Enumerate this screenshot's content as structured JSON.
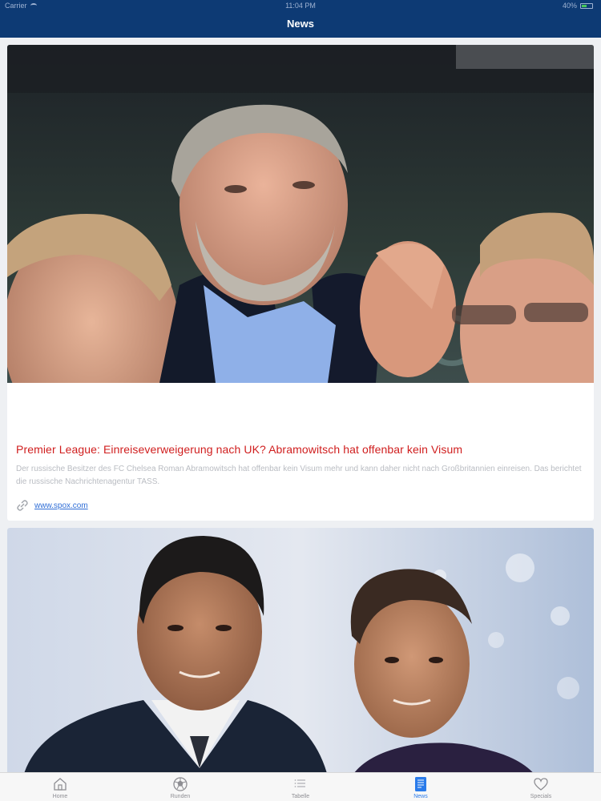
{
  "status_bar": {
    "carrier": "Carrier",
    "time": "11:04 PM",
    "battery": "40%"
  },
  "header": {
    "title": "News"
  },
  "articles": [
    {
      "title": "Premier League: Einreiseverweigerung nach UK? Abramowitsch hat offenbar kein Visum",
      "summary": "Der russische Besitzer des FC Chelsea Roman Abramowitsch hat offenbar kein Visum mehr und kann daher nicht nach Großbritannien einreisen. Das berichtet die russische Nachrichtenagentur TASS.",
      "source": "www.spox.com",
      "image_icon": "news-photo"
    },
    {
      "image_icon": "news-photo"
    }
  ],
  "tabbar": {
    "items": [
      {
        "label": "Home",
        "icon": "house-icon"
      },
      {
        "label": "Runden",
        "icon": "soccer-ball-icon"
      },
      {
        "label": "Tabelle",
        "icon": "list-icon"
      },
      {
        "label": "News",
        "icon": "news-icon",
        "active": true
      },
      {
        "label": "Specials",
        "icon": "heart-icon"
      }
    ]
  },
  "colors": {
    "header": "#0d3a74",
    "title_red": "#d01e1e",
    "link_blue": "#2e6dd6",
    "active_tab": "#2a7bea"
  }
}
